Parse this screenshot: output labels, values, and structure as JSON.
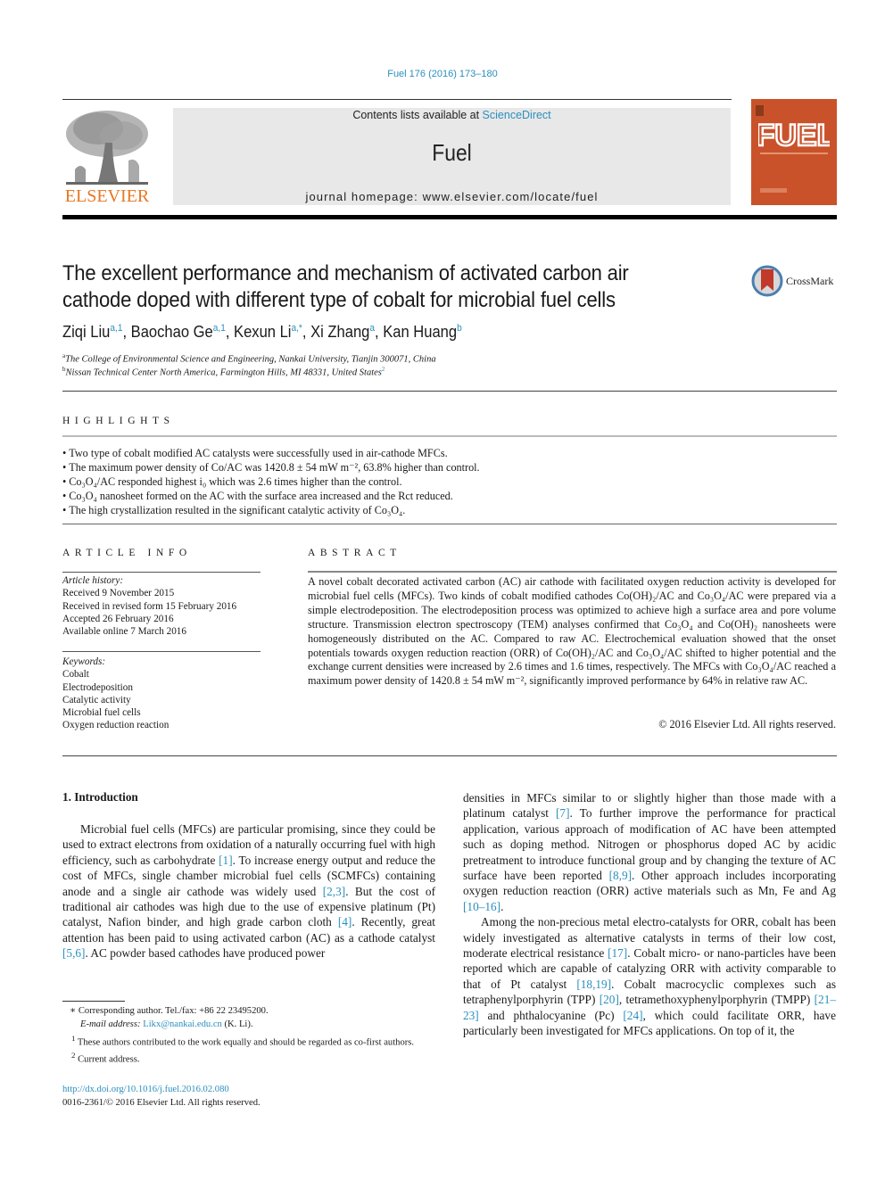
{
  "header": {
    "journal_ref": "Fuel 176 (2016) 173–180",
    "contents_prefix": "Contents lists available at ",
    "contents_link": "ScienceDirect",
    "journal_name": "Fuel",
    "homepage_prefix": "journal homepage: ",
    "homepage_url": "www.elsevier.com/locate/fuel",
    "publisher_logo_text": "ELSEVIER",
    "cover_title": "FUEL",
    "crossmark_label": "CrossMark"
  },
  "colors": {
    "link": "#2a8fbd",
    "elsevier_orange": "#e87722",
    "cover": "#c9522a",
    "masthead_bg": "#e8e8e8"
  },
  "article": {
    "title": "The excellent performance and mechanism of activated carbon air cathode doped with different type of cobalt for microbial fuel cells",
    "authors": [
      {
        "name": "Ziqi Liu",
        "sup": "a,1"
      },
      {
        "name": "Baochao Ge",
        "sup": "a,1"
      },
      {
        "name": "Kexun Li",
        "sup": "a,*"
      },
      {
        "name": "Xi Zhang",
        "sup": "a"
      },
      {
        "name": "Kan Huang",
        "sup": "b"
      }
    ],
    "affiliations": [
      {
        "mark": "a",
        "text": "The College of Environmental Science and Engineering, Nankai University, Tianjin 300071, China"
      },
      {
        "mark": "b",
        "text": "Nissan Technical Center North America, Farmington Hills, MI 48331, United States",
        "sup": "2"
      }
    ]
  },
  "highlights": {
    "heading": "HIGHLIGHTS",
    "items": [
      "Two type of cobalt modified AC catalysts were successfully used in air-cathode MFCs.",
      "The maximum power density of Co/AC was 1420.8 ± 54 mW m⁻², 63.8% higher than control.",
      "Co₃O₄/AC responded highest i₀ which was 2.6 times higher than the control.",
      "Co₃O₄ nanosheet formed on the AC with the surface area increased and the Rct reduced.",
      "The high crystallization resulted in the significant catalytic activity of Co₃O₄."
    ]
  },
  "article_info": {
    "heading": "ARTICLE INFO",
    "history_label": "Article history:",
    "history": [
      "Received 9 November 2015",
      "Received in revised form 15 February 2016",
      "Accepted 26 February 2016",
      "Available online 7 March 2016"
    ],
    "keywords_label": "Keywords:",
    "keywords": [
      "Cobalt",
      "Electrodeposition",
      "Catalytic activity",
      "Microbial fuel cells",
      "Oxygen reduction reaction"
    ]
  },
  "abstract": {
    "heading": "ABSTRACT",
    "text": "A novel cobalt decorated activated carbon (AC) air cathode with facilitated oxygen reduction activity is developed for microbial fuel cells (MFCs). Two kinds of cobalt modified cathodes Co(OH)₂/AC and Co₃O₄/AC were prepared via a simple electrodeposition. The electrodeposition process was optimized to achieve high a surface area and pore volume structure. Transmission electron spectroscopy (TEM) analyses confirmed that Co₃O₄ and Co(OH)₂ nanosheets were homogeneously distributed on the AC. Compared to raw AC. Electrochemical evaluation showed that the onset potentials towards oxygen reduction reaction (ORR) of Co(OH)₂/AC and Co₃O₄/AC shifted to higher potential and the exchange current densities were increased by 2.6 times and 1.6 times, respectively. The MFCs with Co₃O₄/AC reached a maximum power density of 1420.8 ± 54 mW m⁻², significantly improved performance by 64% in relative raw AC.",
    "copyright": "© 2016 Elsevier Ltd. All rights reserved."
  },
  "introduction": {
    "heading": "1. Introduction",
    "left_paragraph": [
      {
        "t": "Microbial fuel cells (MFCs) are particular promising, since they could be used to extract electrons from oxidation of a naturally occurring fuel with high efficiency, such as carbohydrate "
      },
      {
        "ref": "[1]"
      },
      {
        "t": ". To increase energy output and reduce the cost of MFCs, single chamber microbial fuel cells (SCMFCs) containing anode and a single air cathode was widely used "
      },
      {
        "ref": "[2,3]"
      },
      {
        "t": ". But the cost of traditional air cathodes was high due to the use of expensive platinum (Pt) catalyst, Nafion binder, and high grade carbon cloth "
      },
      {
        "ref": "[4]"
      },
      {
        "t": ". Recently, great attention has been paid to using activated carbon (AC) as a cathode catalyst "
      },
      {
        "ref": "[5,6]"
      },
      {
        "t": ". AC powder based cathodes have produced power"
      }
    ],
    "right_paragraph_1": [
      {
        "t": "densities in MFCs similar to or slightly higher than those made with a platinum catalyst "
      },
      {
        "ref": "[7]"
      },
      {
        "t": ". To further improve the performance for practical application, various approach of modification of AC have been attempted such as doping method. Nitrogen or phosphorus doped AC by acidic pretreatment to introduce functional group and by changing the texture of AC surface have been reported "
      },
      {
        "ref": "[8,9]"
      },
      {
        "t": ". Other approach includes incorporating oxygen reduction reaction (ORR) active materials such as Mn, Fe and Ag "
      },
      {
        "ref": "[10–16]"
      },
      {
        "t": "."
      }
    ],
    "right_paragraph_2": [
      {
        "t": "Among the non-precious metal electro-catalysts for ORR, cobalt has been widely investigated as alternative catalysts in terms of their low cost, moderate electrical resistance "
      },
      {
        "ref": "[17]"
      },
      {
        "t": ". Cobalt micro- or nano-particles have been reported which are capable of catalyzing ORR with activity comparable to that of Pt catalyst "
      },
      {
        "ref": "[18,19]"
      },
      {
        "t": ". Cobalt macrocyclic complexes such as tetraphenylporphyrin (TPP) "
      },
      {
        "ref": "[20]"
      },
      {
        "t": ", tetramethoxyphenylporphyrin (TMPP) "
      },
      {
        "ref": "[21–23]"
      },
      {
        "t": " and phthalocyanine (Pc) "
      },
      {
        "ref": "[24]"
      },
      {
        "t": ", which could facilitate ORR, have particularly been investigated for MFCs applications. On top of it, the"
      }
    ]
  },
  "footnotes": {
    "corresponding": "Corresponding author. Tel./fax: +86 22 23495200.",
    "email_label": "E-mail address:",
    "email": "Likx@nankai.edu.cn",
    "email_suffix": " (K. Li).",
    "fn1": "These authors contributed to the work equally and should be regarded as co-first authors.",
    "fn2": "Current address.",
    "doi": "http://dx.doi.org/10.1016/j.fuel.2016.02.080",
    "issn": "0016-2361/© 2016 Elsevier Ltd. All rights reserved."
  }
}
